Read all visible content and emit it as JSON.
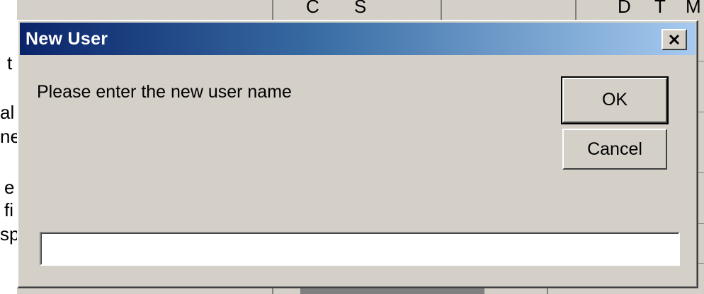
{
  "background": {
    "left_fragments": [
      "t",
      "al",
      "ne",
      "e",
      "fi",
      "sp"
    ],
    "top_fragments": [
      "C",
      "S",
      "D",
      "T",
      "M"
    ]
  },
  "dialog": {
    "title": "New User",
    "close_glyph": "✕",
    "prompt": "Please enter the new user name",
    "ok_label": "OK",
    "cancel_label": "Cancel",
    "input_value": ""
  },
  "colors": {
    "titlebar_start": "#0a246a",
    "titlebar_end": "#a6caf0",
    "dialog_face": "#d4d0c8"
  }
}
